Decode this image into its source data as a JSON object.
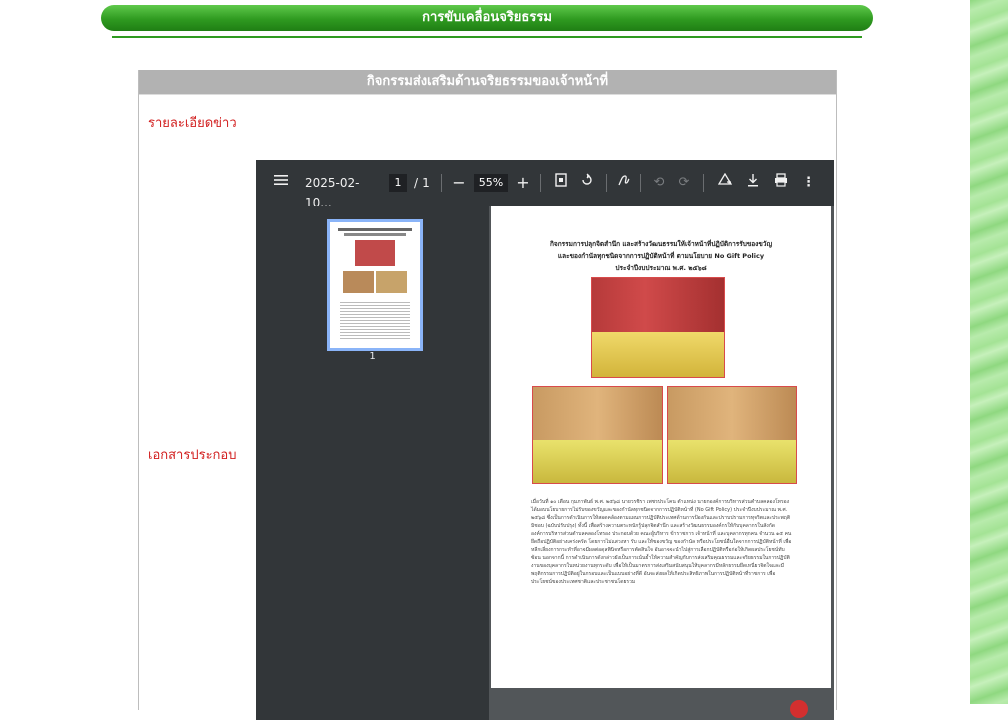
{
  "banner": {
    "title": "การขับเคลื่อนจริยธรรม"
  },
  "panel": {
    "header": "กิจกรรมส่งเสริมด้านจริยธรรมของเจ้าหน้าที่",
    "detail_label": "รายละเอียดข่าว",
    "attachment_label": "เอกสารประกอบ"
  },
  "pdf_viewer": {
    "file_name": "2025-02-10...",
    "current_page": "1",
    "page_sep": "/",
    "total_pages": "1",
    "zoom": "55%",
    "thumbnail_label": "1",
    "icons": [
      "menu-icon",
      "zoom-out-icon",
      "zoom-in-icon",
      "fit-page-icon",
      "rotate-icon",
      "annotate-icon",
      "undo-icon",
      "redo-icon",
      "drive-icon",
      "download-icon",
      "print-icon",
      "more-icon"
    ]
  },
  "document": {
    "title_line1": "กิจกรรมการปลุกจิตสำนึก และสร้างวัฒนธรรมให้เจ้าหน้าที่ปฏิบัติการรับของขวัญ",
    "title_line2": "และของกำนัลทุกชนิดจากการปฏิบัติหน้าที่ ตามนโยบาย No Gift Policy",
    "title_line3": "ประจำปีงบประมาณ พ.ศ. ๒๕๖๘",
    "body": "เมื่อวันที่ ๑๐ เดือน กุมภาพันธ์ พ.ศ. ๒๕๖๘ นายวรชิรา เพชรประโคน ตำแหน่ง นายกองค์การบริหารส่วนตำบลคลองโทรอง ได้มอบนโยบายการไม่รับของขวัญและของกำนัลทุกชนิดจากการปฏิบัติหน้าที่ (No Gift Policy) ประจำปีงบประมาณ พ.ศ. ๒๕๖๘ ซึ่งเป็นการดำเนินการให้สอดคล้องตามแผนการปฏิบัติประเทศด้านการป้องกันและปราบปรามการทุจริตและประพฤติมิชอบ (ฉบับปรับปรุง) ทั้งนี้ เพื่อสร้างความตระหนักรู้ปลุกจิตสำนึก และสร้างวัฒนธรรมองค์กรให้กับบุคลากรในสังกัด องค์การบริหารส่วนตำบลคลองโทรอง ประกอบด้วย คณะผู้บริหาร ข้าราชการ เจ้าหน้าที่ และบุคลากรทุกคน จำนวน ๑๕ คน ยึดถือปฏิบัติอย่างเคร่งครัด โดยการไม่แสวงหา รับ และให้ของขวัญ ของกำนัล หรือประโยชน์อื่นใดจากการปฏิบัติหน้าที่ เพื่อหลีกเลี่ยงการกระทำที่อาจมีผลต่อดุลพินิจหรือการตัดสินใจ อันอาจจะนำไปสู่การเลือกปฏิบัติหรือก่อให้เกิดผลประโยชน์ทับซ้อน นอกจากนี้ การดำเนินการดังกล่าวยังเป็นการเน้นย้ำให้ความสำคัญกับการส่งเสริมคุณธรรมและจริยธรรมในการปฏิบัติงานของบุคลากรในหน่วยงานทุกระดับ เพื่อให้เป็นมาตรการส่งเสริมสนับสนุนให้บุคลากรมีหลักธรรมยึดเหนี่ยวจิตใจและมีพฤติกรรมการปฏิบัติอยู่ในกรอบและเป็นแบบอย่างที่ดี อันจะส่งผลให้เกิดประสิทธิภาพในการปฏิบัติหน้าที่ราชการ เพื่อประโยชน์ของประเทศชาติและประชาชนโดยรวม"
  }
}
